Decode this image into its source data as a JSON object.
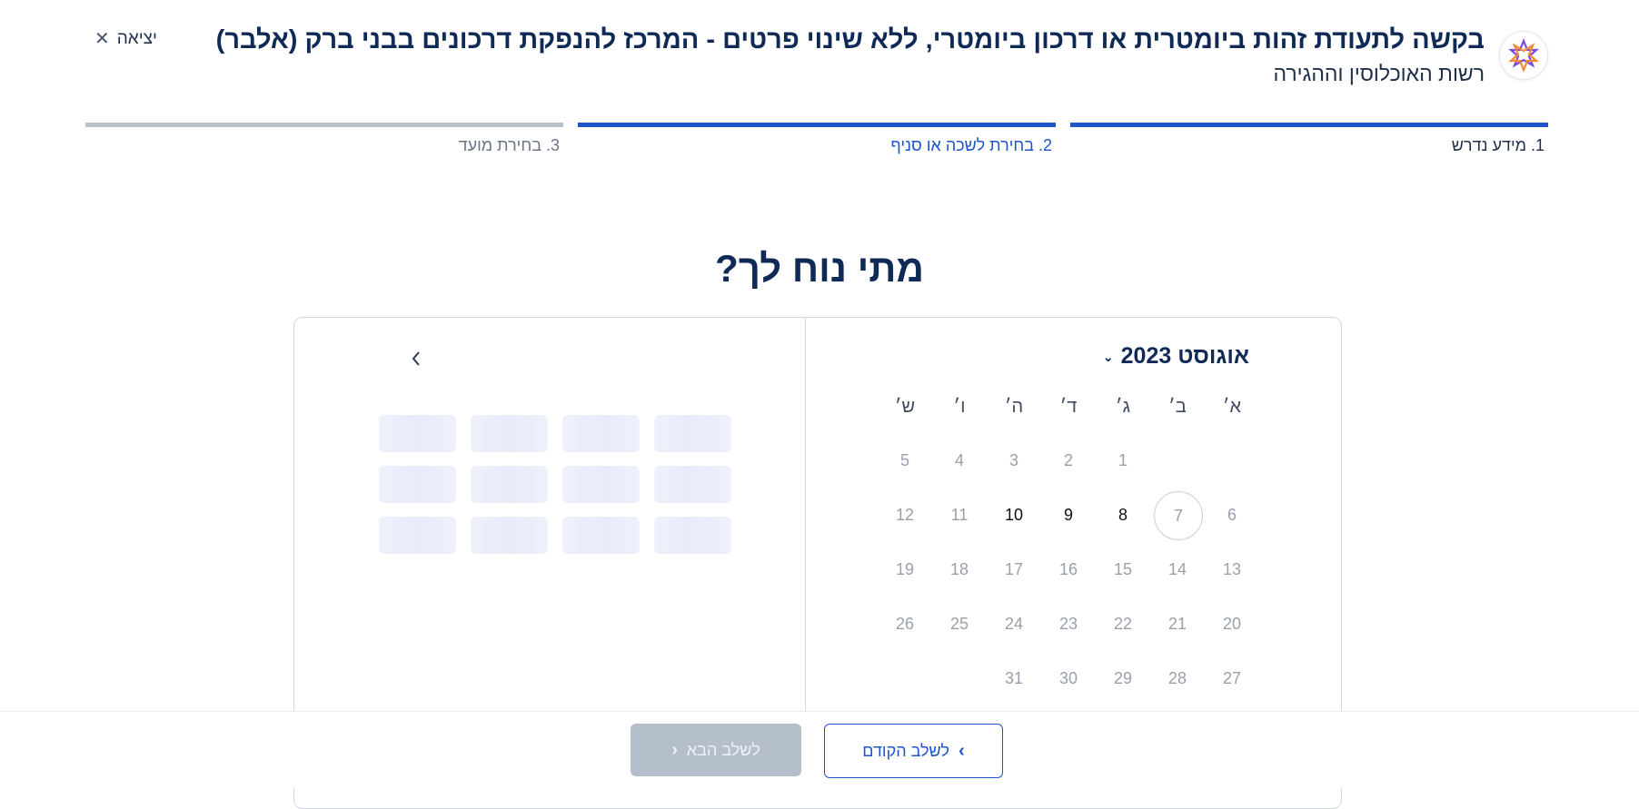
{
  "header": {
    "title": "בקשה לתעודת זהות ביומטרית או דרכון ביומטרי, ללא שינוי פרטים - המרכז להנפקת דרכונים בבני ברק (אלבר)",
    "subtitle": "רשות האוכלוסין וההגירה",
    "exit_label": "יציאה"
  },
  "stepper": [
    {
      "label": "1. מידע נדרש",
      "state": "complete",
      "color": "#1e55c8"
    },
    {
      "label": "2. בחירת לשכה או סניף",
      "state": "active",
      "color": "#1e55c8"
    },
    {
      "label": "3. בחירת מועד",
      "state": "upcoming",
      "color": "#b9c1cd"
    }
  ],
  "question": "מתי נוח לך?",
  "calendar": {
    "month_label": "אוגוסט 2023",
    "weekdays": [
      "א׳",
      "ב׳",
      "ג׳",
      "ד׳",
      "ה׳",
      "ו׳",
      "ש׳"
    ],
    "weeks": [
      [
        "",
        "",
        "1",
        "2",
        "3",
        "4",
        "5"
      ],
      [
        "6",
        "7",
        "8",
        "9",
        "10",
        "11",
        "12"
      ],
      [
        "13",
        "14",
        "15",
        "16",
        "17",
        "18",
        "19"
      ],
      [
        "20",
        "21",
        "22",
        "23",
        "24",
        "25",
        "26"
      ],
      [
        "27",
        "28",
        "29",
        "30",
        "31",
        "",
        ""
      ]
    ],
    "available_days": [
      "8",
      "9",
      "10"
    ],
    "selected_day": "7",
    "nav_icon": "chevron-right-icon"
  },
  "footer": {
    "prev_label": "לשלב הקודם",
    "next_label": "לשלב הבא",
    "accent_color": "#1e55c8",
    "disabled_color": "#b5bfcc"
  }
}
